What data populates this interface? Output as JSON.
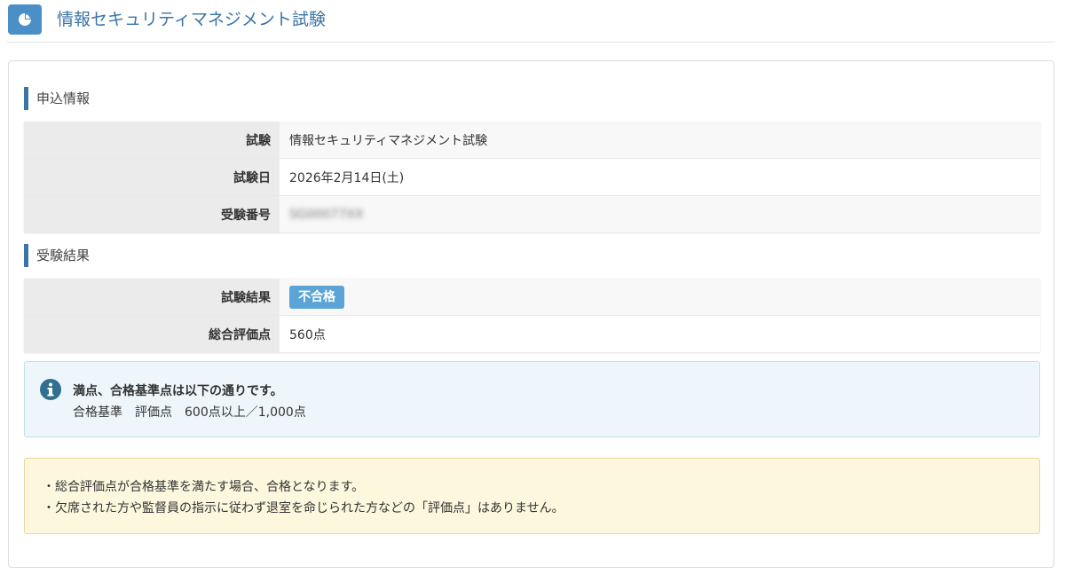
{
  "header": {
    "title": "情報セキュリティマネジメント試験",
    "icon": "pie-chart-icon",
    "icon_bg": "#4a8fc6"
  },
  "application": {
    "heading": "申込情報",
    "rows": [
      {
        "label": "試験",
        "value": "情報セキュリティマネジメント試験"
      },
      {
        "label": "試験日",
        "value": "2026年2月14日(土)"
      },
      {
        "label": "受験番号",
        "value": "SG00077XX"
      }
    ]
  },
  "result": {
    "heading": "受験結果",
    "rows": [
      {
        "label": "試験結果",
        "value": "不合格"
      },
      {
        "label": "総合評価点",
        "value": "560点"
      }
    ],
    "badge_color": "#5aa5d6"
  },
  "info": {
    "icon": "info-circle-icon",
    "title": "満点、合格基準点は以下の通りです。",
    "criteria_label": "合格基準",
    "score_label": "評価点",
    "score_value": "600点以上／1,000点"
  },
  "notes": [
    "・総合評価点が合格基準を満たす場合、合格となります。",
    "・欠席された方や監督員の指示に従わず退室を命じられた方などの「評価点」はありません。"
  ],
  "colors": {
    "accent": "#3b74a6",
    "info_bg": "#eef6fb",
    "note_bg": "#fcf7dd"
  }
}
